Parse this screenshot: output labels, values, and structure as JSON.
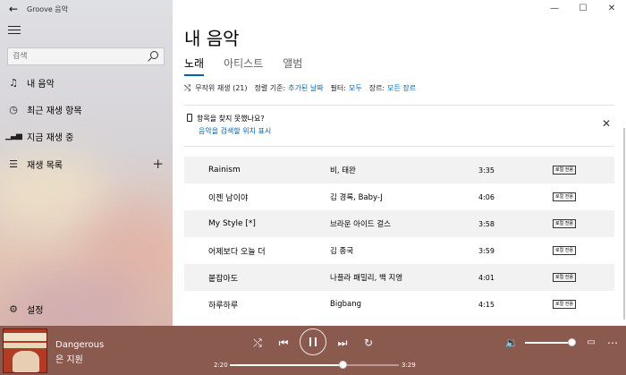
{
  "app": {
    "title": "Groove 음악"
  },
  "sidebar": {
    "search_placeholder": "검색",
    "items": [
      {
        "label": "내 음악",
        "icon": "music-note-icon"
      },
      {
        "label": "최근 재생 항목",
        "icon": "clock-icon"
      },
      {
        "label": "지금 재생 중",
        "icon": "bars-icon"
      },
      {
        "label": "재생 목록",
        "icon": "list-icon"
      }
    ],
    "settings_label": "설정"
  },
  "main": {
    "title": "내 음악",
    "tabs": [
      {
        "label": "노래",
        "active": true
      },
      {
        "label": "아티스트",
        "active": false
      },
      {
        "label": "앨범",
        "active": false
      }
    ],
    "filters": {
      "shuffle": "무작위 재생 (21)",
      "sort_label": "정렬 기준:",
      "sort_value": "추가된 날짜",
      "filter_label": "필터:",
      "filter_value": "모두",
      "genre_label": "장르:",
      "genre_value": "모든 장르"
    },
    "notice": {
      "text": "항목을 찾지 못했나요?",
      "link": "음악을 검색할 위치 표시"
    },
    "songs": [
      {
        "title": "Rainism",
        "artist": "비, 태완",
        "duration": "3:35",
        "badge": "로컬 전용"
      },
      {
        "title": "이젠 남이야",
        "artist": "김 경록, Baby-J",
        "duration": "4:06",
        "badge": "로컬 전용"
      },
      {
        "title": "My Style [*]",
        "artist": "브라운 아이드 걸스",
        "duration": "3:58",
        "badge": "로컬 전용"
      },
      {
        "title": "어제보다 오늘 더",
        "artist": "김 종국",
        "duration": "3:59",
        "badge": "로컬 전용"
      },
      {
        "title": "붙잡아도",
        "artist": "나플라 패밀리, 백 지영",
        "duration": "4:01",
        "badge": "로컬 전용"
      },
      {
        "title": "하루하루",
        "artist": "Bigbang",
        "duration": "4:15",
        "badge": "로컬 전용"
      }
    ]
  },
  "player": {
    "album_art_text": "G-ONE G-CODE",
    "title": "Dangerous",
    "artist": "은 지원",
    "elapsed": "2:20",
    "total": "3:29",
    "progress": 0.67,
    "volume": 1.0
  },
  "colors": {
    "accent": "#0063b1",
    "player_bg": "#8a5a4f"
  }
}
